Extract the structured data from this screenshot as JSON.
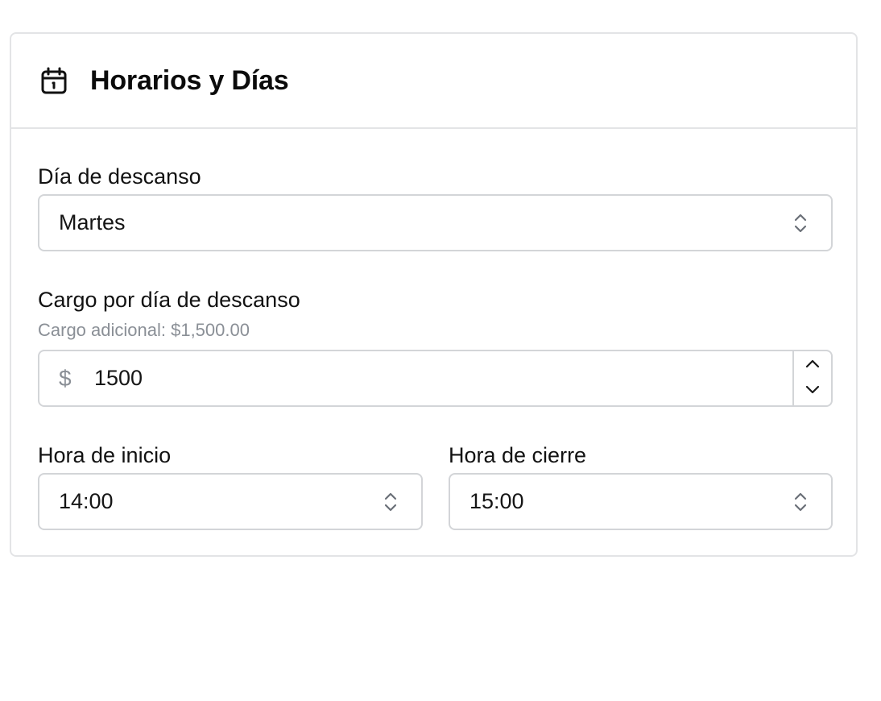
{
  "card": {
    "title": "Horarios y Días",
    "icon": "calendar-icon"
  },
  "rest_day": {
    "label": "Día de descanso",
    "selected": "Martes"
  },
  "rest_day_charge": {
    "label": "Cargo por día de descanso",
    "help": "Cargo adicional: $1,500.00",
    "currency_symbol": "$",
    "value": "1500"
  },
  "start_time": {
    "label": "Hora de inicio",
    "selected": "14:00"
  },
  "end_time": {
    "label": "Hora de cierre",
    "selected": "15:00"
  },
  "colors": {
    "border": "#d3d5d8",
    "card_border": "#e3e4e6",
    "muted_text": "#8a8f96",
    "text": "#121212"
  }
}
